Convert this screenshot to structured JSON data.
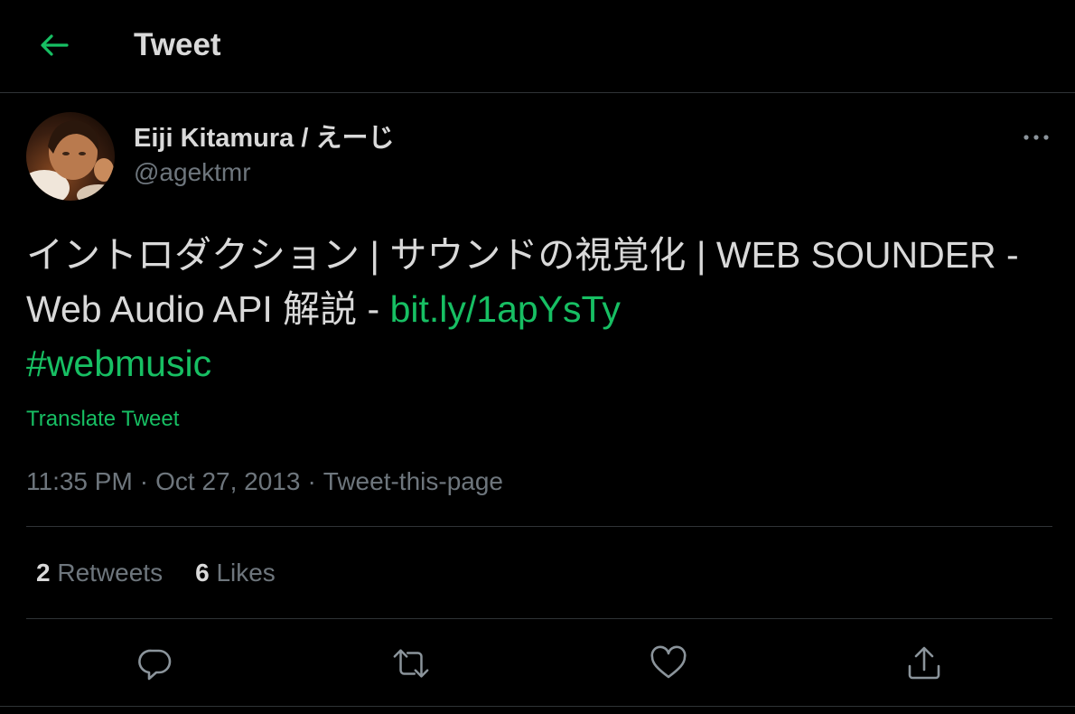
{
  "header": {
    "back_icon": "arrow-left-icon",
    "title": "Tweet"
  },
  "colors": {
    "accent": "#17bf63",
    "text": "#d9d9d9",
    "muted": "#6e767d",
    "border": "#2f3336",
    "background": "#000000"
  },
  "author": {
    "display_name": "Eiji Kitamura / えーじ",
    "handle": "@agektmr"
  },
  "tweet": {
    "text": "イントロダクション | サウンドの視覚化 | WEB SOUNDER - Web Audio API 解説 - ",
    "link": "bit.ly/1apYsTy",
    "hashtag": "#webmusic",
    "translate_label": "Translate Tweet",
    "time": "11:35 PM",
    "date": "Oct 27, 2013",
    "source": "Tweet-this-page"
  },
  "stats": {
    "retweets_count": "2",
    "retweets_label": "Retweets",
    "likes_count": "6",
    "likes_label": "Likes"
  },
  "actions": [
    "reply-icon",
    "retweet-icon",
    "like-icon",
    "share-icon"
  ]
}
